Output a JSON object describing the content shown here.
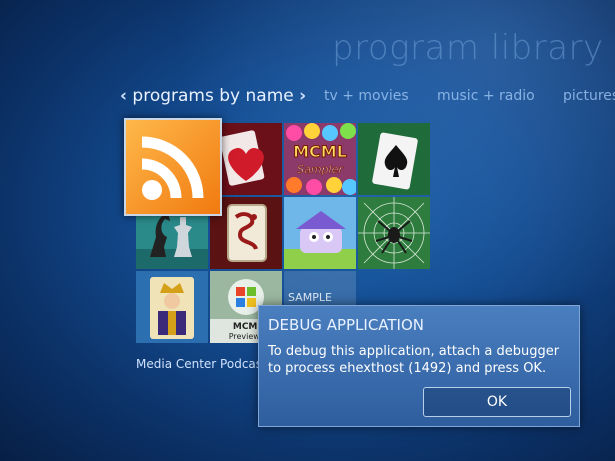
{
  "app": {
    "title": "program library"
  },
  "nav": {
    "active_label": "programs by name",
    "tabs": [
      "tv + movies",
      "music + radio",
      "pictures"
    ]
  },
  "tiles": [
    {
      "name": "rss-feed-tile",
      "icon": "rss-icon"
    },
    {
      "name": "hearts-tile",
      "icon": "heart-card-icon"
    },
    {
      "name": "mcml-sampler-tile",
      "icon": "candy-icon",
      "label": "MCML Sampler"
    },
    {
      "name": "solitaire-tile",
      "icon": "spade-card-icon"
    },
    {
      "name": "chess-tile",
      "icon": "chess-icon"
    },
    {
      "name": "mahjong-tile",
      "icon": "mahjong-icon"
    },
    {
      "name": "purble-place-tile",
      "icon": "purble-icon"
    },
    {
      "name": "spider-solitaire-tile",
      "icon": "spider-icon"
    },
    {
      "name": "freecell-tile",
      "icon": "king-card-icon"
    },
    {
      "name": "mcml-preview-tile",
      "icon": "windows-logo-icon",
      "label": "MCML Preview T"
    },
    {
      "name": "sample-tile",
      "label": "SAMPLE"
    }
  ],
  "caption": "Media Center Podcast",
  "dialog": {
    "title": "DEBUG APPLICATION",
    "message": "To debug this application, attach a debugger to process ehexthost (1492) and press OK.",
    "ok_label": "OK"
  }
}
